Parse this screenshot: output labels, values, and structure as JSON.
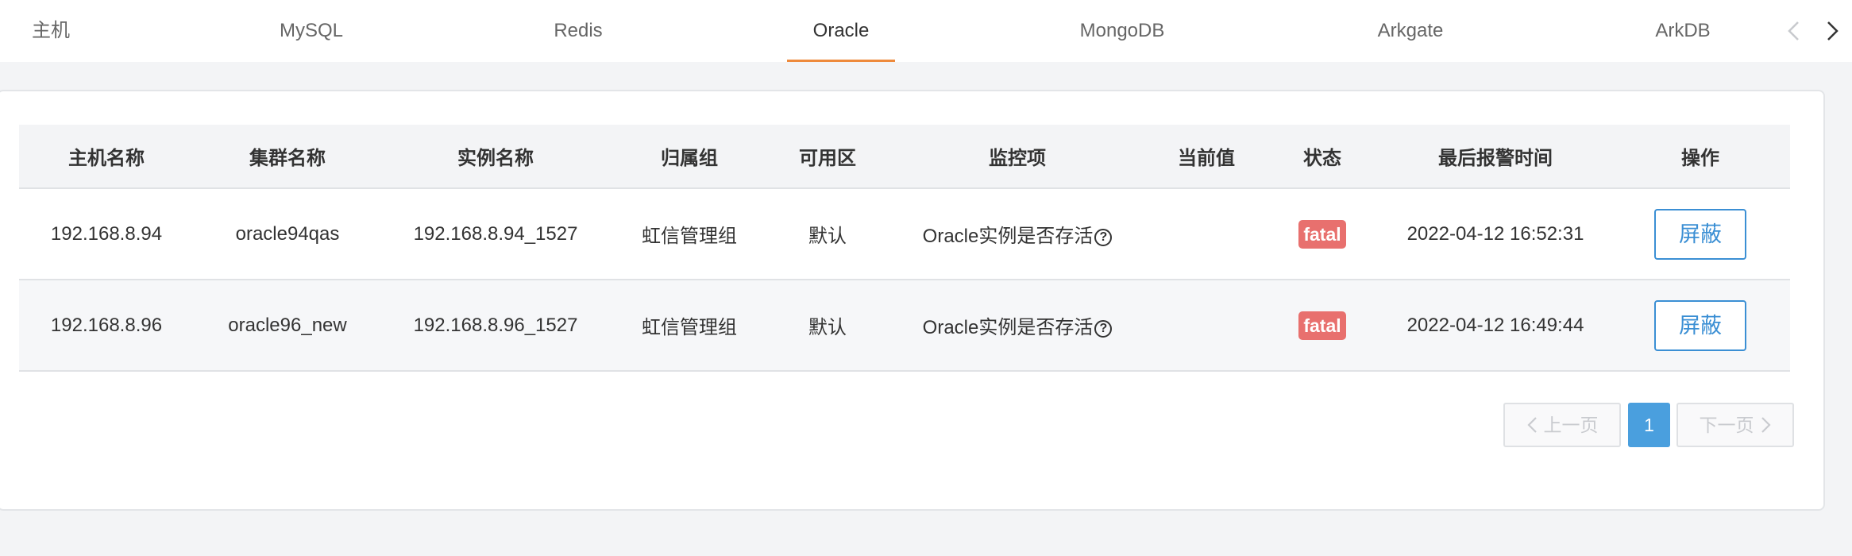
{
  "tabs": [
    {
      "label": "主机",
      "active": false
    },
    {
      "label": "MySQL",
      "active": false
    },
    {
      "label": "Redis",
      "active": false
    },
    {
      "label": "Oracle",
      "active": true
    },
    {
      "label": "MongoDB",
      "active": false
    },
    {
      "label": "Arkgate",
      "active": false
    },
    {
      "label": "ArkDB",
      "active": false
    }
  ],
  "table": {
    "headers": {
      "host_name": "主机名称",
      "cluster_name": "集群名称",
      "instance_name": "实例名称",
      "group": "归属组",
      "zone": "可用区",
      "monitor_item": "监控项",
      "current_value": "当前值",
      "status": "状态",
      "last_alarm_time": "最后报警时间",
      "action": "操作"
    },
    "rows": [
      {
        "host_name": "192.168.8.94",
        "cluster_name": "oracle94qas",
        "instance_name": "192.168.8.94_1527",
        "group": "虹信管理组",
        "zone": "默认",
        "monitor_item": "Oracle实例是否存活",
        "current_value": "",
        "status": "fatal",
        "last_alarm_time": "2022-04-12 16:52:31",
        "action": "屏蔽"
      },
      {
        "host_name": "192.168.8.96",
        "cluster_name": "oracle96_new",
        "instance_name": "192.168.8.96_1527",
        "group": "虹信管理组",
        "zone": "默认",
        "monitor_item": "Oracle实例是否存活",
        "current_value": "",
        "status": "fatal",
        "last_alarm_time": "2022-04-12 16:49:44",
        "action": "屏蔽"
      }
    ]
  },
  "pagination": {
    "prev_label": "上一页",
    "current_page": "1",
    "next_label": "下一页"
  },
  "colors": {
    "accent": "#ee8a3c",
    "primary": "#3b8fd4",
    "fatal": "#e8706e"
  }
}
